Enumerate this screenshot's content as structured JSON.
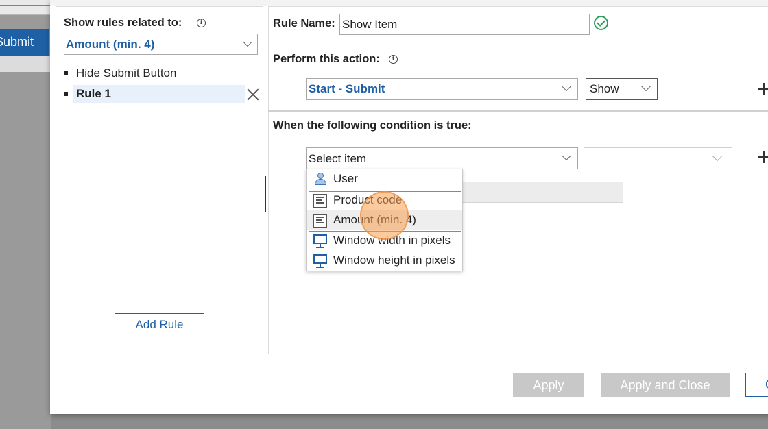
{
  "background": {
    "submit_label": "Submit"
  },
  "left": {
    "show_rules_label": "Show rules related to:",
    "related_select_value": "Amount (min. 4)",
    "rules": [
      {
        "label": "Hide Submit Button"
      },
      {
        "label": "Rule 1"
      }
    ],
    "add_rule_label": "Add Rule"
  },
  "right": {
    "rule_name_label": "Rule Name:",
    "rule_name_value": "Show Item",
    "perform_action_label": "Perform this action:",
    "action_target_value": "Start - Submit",
    "action_value": "Show",
    "condition_label": "When the following condition is true:",
    "condition_item_value": "Select item",
    "condition_operator_value": ""
  },
  "dropdown": {
    "items": [
      {
        "label": "User",
        "icon": "user-icon"
      },
      {
        "label": "Product code",
        "icon": "field-icon"
      },
      {
        "label": "Amount (min. 4)",
        "icon": "field-icon"
      },
      {
        "label": "Window width in pixels",
        "icon": "monitor-icon"
      },
      {
        "label": "Window height in pixels",
        "icon": "monitor-icon"
      }
    ]
  },
  "footer": {
    "apply_label": "Apply",
    "apply_close_label": "Apply and Close",
    "cancel_label": "C"
  },
  "colors": {
    "accent": "#1f5fa3",
    "success": "#2e9e5b",
    "disabled": "#c8c8c8"
  }
}
